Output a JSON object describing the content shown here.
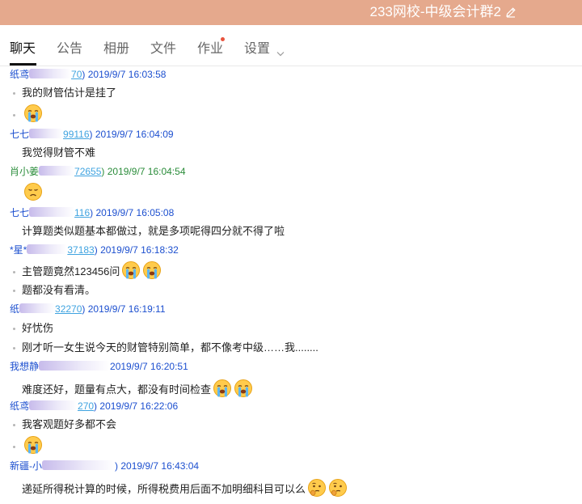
{
  "window": {
    "title": "233网校-中级会计群2"
  },
  "tabs": [
    {
      "label": "聊天",
      "active": true
    },
    {
      "label": "公告"
    },
    {
      "label": "相册"
    },
    {
      "label": "文件"
    },
    {
      "label": "作业",
      "badge": true
    },
    {
      "label": "设置"
    }
  ],
  "messages": [
    {
      "name": "纸鸢",
      "id_visible": "70",
      "time": "2019/9/7 16:03:58",
      "lines": [
        {
          "text": "我的财管估计是挂了",
          "bullet": true
        },
        {
          "text": "",
          "bullet": true,
          "emojis": [
            "crying-emoji"
          ]
        }
      ]
    },
    {
      "name": "七七",
      "id_visible": "99116",
      "time": "2019/9/7 16:04:09",
      "lines": [
        {
          "text": "我觉得财管不难",
          "bullet": false
        }
      ]
    },
    {
      "name": "肖小姜",
      "id_visible": "72655",
      "time": "2019/9/7 16:04:54",
      "color": "green",
      "lines": [
        {
          "text": "",
          "bullet": false,
          "emojis": [
            "sad-emoji"
          ]
        }
      ]
    },
    {
      "name": "七七",
      "id_visible": "116",
      "time": "2019/9/7 16:05:08",
      "lines": [
        {
          "text": "计算题类似题基本都做过，就是多项呢得四分就不得了啦",
          "bullet": false
        }
      ]
    },
    {
      "name": "*星*",
      "id_visible": "37183",
      "time": "2019/9/7 16:18:32",
      "lines": [
        {
          "text": "主管题竟然123456问",
          "bullet": true,
          "emojis": [
            "crying-emoji",
            "crying-emoji"
          ]
        },
        {
          "text": "题都没有看清。",
          "bullet": true
        }
      ]
    },
    {
      "name": "纸",
      "id_visible": "32270",
      "time": "2019/9/7 16:19:11",
      "lines": [
        {
          "text": "好忧伤",
          "bullet": true
        },
        {
          "text": "刚才听一女生说今天的财管特别简单，都不像考中级……我........",
          "bullet": true
        }
      ]
    },
    {
      "name": "我想静",
      "id_visible": "",
      "time": "2019/9/7 16:20:51",
      "lines": [
        {
          "text": "难度还好，题量有点大，都没有时间检查",
          "bullet": false,
          "emojis": [
            "crying-emoji",
            "crying-emoji"
          ]
        }
      ]
    },
    {
      "name": "纸鸢",
      "id_visible": "270",
      "time": "2019/9/7 16:22:06",
      "lines": [
        {
          "text": "我客观题好多都不会",
          "bullet": true
        },
        {
          "text": "",
          "bullet": true,
          "emojis": [
            "crying-emoji"
          ]
        }
      ]
    },
    {
      "name": "新疆-小",
      "id_visible": "",
      "time": "2019/9/7 16:43:04",
      "lines": [
        {
          "text": "递延所得税计算的时候，所得税费用后面不加明细科目可以么",
          "bullet": false,
          "emojis": [
            "thinking-emoji",
            "thinking-emoji"
          ]
        }
      ]
    }
  ]
}
